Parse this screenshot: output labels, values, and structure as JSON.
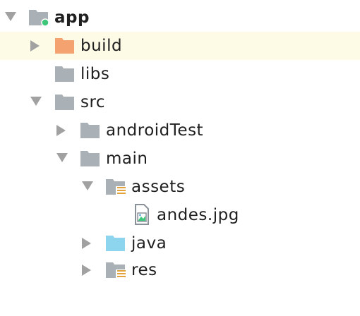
{
  "tree": {
    "app": {
      "label": "app",
      "icon": "module-folder-icon"
    },
    "build": {
      "label": "build",
      "icon": "excluded-folder-icon",
      "color": "#f4a370"
    },
    "libs": {
      "label": "libs",
      "icon": "folder-icon"
    },
    "src": {
      "label": "src",
      "icon": "folder-icon"
    },
    "androidTest": {
      "label": "androidTest",
      "icon": "folder-icon"
    },
    "main": {
      "label": "main",
      "icon": "folder-icon"
    },
    "assets": {
      "label": "assets",
      "icon": "resource-folder-icon"
    },
    "andes": {
      "label": "andes.jpg",
      "icon": "image-file-icon"
    },
    "java": {
      "label": "java",
      "icon": "source-folder-icon",
      "color": "#8dd4ef"
    },
    "res": {
      "label": "res",
      "icon": "resource-folder-icon"
    }
  },
  "colors": {
    "folder": "#a9b0b6",
    "selected_row": "#fdfae6",
    "arrow": "#a1a1a1",
    "module_dot": "#3ec77a",
    "resource_lines": "#e2a33a"
  }
}
